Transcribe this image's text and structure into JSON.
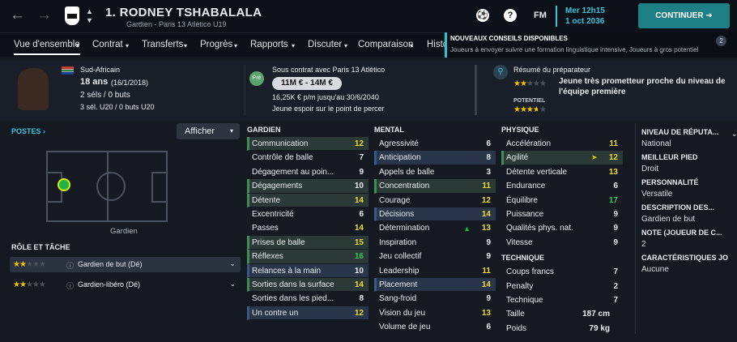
{
  "nav": {
    "back": "←",
    "forward": "→"
  },
  "player": {
    "title": "1. RODNEY TSHABALALA",
    "subtitle": "Gardien - Paris 13 Atlético U19"
  },
  "header": {
    "fm": "FM",
    "date_line1": "Mer 12h15",
    "date_line2": "1 oct 2036",
    "continue": "CONTINUER"
  },
  "menu": [
    "Vue d'ensemble",
    "Contrat",
    "Transferts",
    "Progrès",
    "Rapports",
    "Discuter",
    "Comparaison",
    "Histo"
  ],
  "notification": {
    "title": "NOUVEAUX CONSEILS DISPONIBLES",
    "message": "Joueurs à envoyer suivre une formation linguistique intensive, Joueurs à gros potentiel",
    "count": "2"
  },
  "bio": {
    "nation": "Sud-Africain",
    "age": "18 ans",
    "dob": "(16/1/2018)",
    "caps": "2 séls / 0 buts",
    "u20": "3 sél. U20 / 0 buts U20"
  },
  "contract": {
    "badge": "Pré",
    "status": "Sous contrat avec Paris 13 Atlético",
    "value": "11M € - 14M €",
    "wage": "16,25K € p/m jusqu'au 30/6/2040",
    "note": "Jeune espoir sur le point de percer"
  },
  "scout": {
    "title": "Résumé du préparateur",
    "summary_line1": "Jeune très prometteur proche du niveau de",
    "summary_line2": "l'équipe première",
    "potential_label": "POTENTIEL",
    "ability_stars": 2,
    "potential_stars": 3.5
  },
  "positions": {
    "title": "POSTES",
    "filter": "Afficher",
    "position_name": "Gardien"
  },
  "roles": {
    "title": "RÔLE ET TÂCHE",
    "items": [
      {
        "label": "Gardien de but (Dé)",
        "stars": 2
      },
      {
        "label": "Gardien-libéro (Dé)",
        "stars": 2
      }
    ]
  },
  "goalkeeping": {
    "title": "GARDIEN",
    "rows": [
      {
        "name": "Communication",
        "value": "12",
        "hl": "g"
      },
      {
        "name": "Contrôle de balle",
        "value": "7",
        "hl": ""
      },
      {
        "name": "Dégagement au poin...",
        "value": "9",
        "hl": ""
      },
      {
        "name": "Dégagements",
        "value": "10",
        "hl": "g"
      },
      {
        "name": "Détente",
        "value": "14",
        "hl": "g"
      },
      {
        "name": "Excentricité",
        "value": "6",
        "hl": ""
      },
      {
        "name": "Passes",
        "value": "14",
        "hl": ""
      },
      {
        "name": "Prises de balle",
        "value": "15",
        "hl": "g"
      },
      {
        "name": "Réflexes",
        "value": "16",
        "hl": "g"
      },
      {
        "name": "Relances à la main",
        "value": "10",
        "hl": "b"
      },
      {
        "name": "Sorties dans la surface",
        "value": "14",
        "hl": "g"
      },
      {
        "name": "Sorties dans les pied...",
        "value": "8",
        "hl": ""
      },
      {
        "name": "Un contre un",
        "value": "12",
        "hl": "b"
      }
    ]
  },
  "mental": {
    "title": "MENTAL",
    "rows": [
      {
        "name": "Agressivité",
        "value": "6",
        "hl": ""
      },
      {
        "name": "Anticipation",
        "value": "8",
        "hl": "b"
      },
      {
        "name": "Appels de balle",
        "value": "3",
        "hl": ""
      },
      {
        "name": "Concentration",
        "value": "11",
        "hl": "g"
      },
      {
        "name": "Courage",
        "value": "12",
        "hl": ""
      },
      {
        "name": "Décisions",
        "value": "14",
        "hl": "b"
      },
      {
        "name": "Détermination",
        "value": "13",
        "hl": ""
      },
      {
        "name": "Inspiration",
        "value": "9",
        "hl": ""
      },
      {
        "name": "Jeu collectif",
        "value": "9",
        "hl": ""
      },
      {
        "name": "Leadership",
        "value": "11",
        "hl": ""
      },
      {
        "name": "Placement",
        "value": "14",
        "hl": "b"
      },
      {
        "name": "Sang-froid",
        "value": "9",
        "hl": ""
      },
      {
        "name": "Vision du jeu",
        "value": "13",
        "hl": ""
      },
      {
        "name": "Volume de jeu",
        "value": "6",
        "hl": ""
      }
    ]
  },
  "physical": {
    "title": "PHYSIQUE",
    "rows": [
      {
        "name": "Accélération",
        "value": "11",
        "hl": ""
      },
      {
        "name": "Agilité",
        "value": "12",
        "hl": "g"
      },
      {
        "name": "Détente verticale",
        "value": "13",
        "hl": ""
      },
      {
        "name": "Endurance",
        "value": "6",
        "hl": ""
      },
      {
        "name": "Équilibre",
        "value": "17",
        "hl": ""
      },
      {
        "name": "Puissance",
        "value": "9",
        "hl": ""
      },
      {
        "name": "Qualités phys. nat.",
        "value": "9",
        "hl": ""
      },
      {
        "name": "Vitesse",
        "value": "9",
        "hl": ""
      }
    ]
  },
  "technical": {
    "title": "TECHNIQUE",
    "rows": [
      {
        "name": "Coups francs",
        "value": "7",
        "hl": ""
      },
      {
        "name": "Penalty",
        "value": "2",
        "hl": ""
      },
      {
        "name": "Technique",
        "value": "7",
        "hl": ""
      }
    ]
  },
  "measures": {
    "height_label": "Taille",
    "height": "187 cm",
    "weight_label": "Poids",
    "weight": "79 kg"
  },
  "right_panel": [
    {
      "label": "NIVEAU DE RÉPUTA...",
      "value": "National"
    },
    {
      "label": "MEILLEUR PIED",
      "value": "Droit"
    },
    {
      "label": "PERSONNALITÉ",
      "value": "Versatile"
    },
    {
      "label": "DESCRIPTION DES...",
      "value": "Gardien de but"
    },
    {
      "label": "NOTE (JOUEUR DE C...",
      "value": "2"
    },
    {
      "label": "CARACTÉRISTIQUES JO",
      "value": "Aucune"
    }
  ]
}
